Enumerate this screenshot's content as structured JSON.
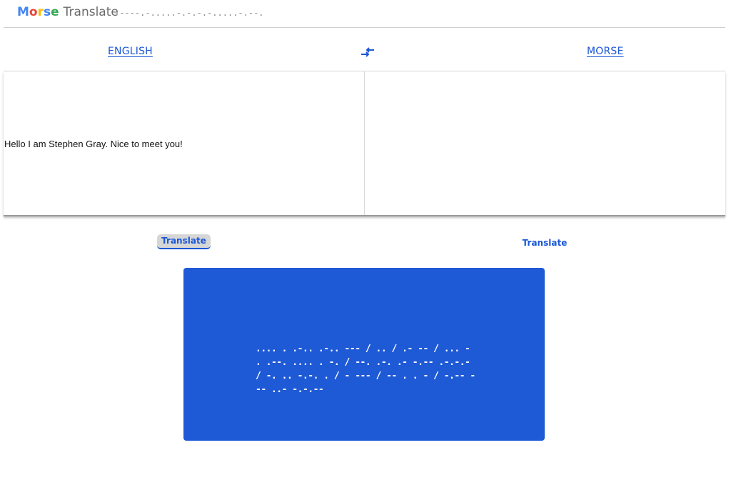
{
  "header": {
    "logo_letters": [
      "M",
      "o",
      "r",
      "s",
      "e"
    ],
    "logo_rest": "Translate",
    "logo_morse": "-----.-.....-.-.-.-.....-.--."
  },
  "language_bar": {
    "source_language": "ENGLISH",
    "target_language": "MORSE",
    "swap_icon": "swap-arrows-icon"
  },
  "input_panel": {
    "text": "Hello I am Stephen Gray. Nice to meet you!"
  },
  "output_panel": {
    "text": ""
  },
  "buttons": {
    "translate_left": "Translate",
    "translate_right": "Translate"
  },
  "output_card": {
    "text": ".... . .-.. .-.. --- / .. / .- -- / ... - . .--. .... . -. / --. .-. .- -.-- .-.-.- / -. .. -.-. . / - --- / -- . . - / -.-- --- ..- -.-.--"
  },
  "colors": {
    "accent": "#1a56d6",
    "card_background": "#1f5ad6",
    "logo_blue": "#4285f4",
    "logo_red": "#ea4335",
    "logo_yellow": "#fbbc05",
    "logo_green": "#34a853"
  }
}
